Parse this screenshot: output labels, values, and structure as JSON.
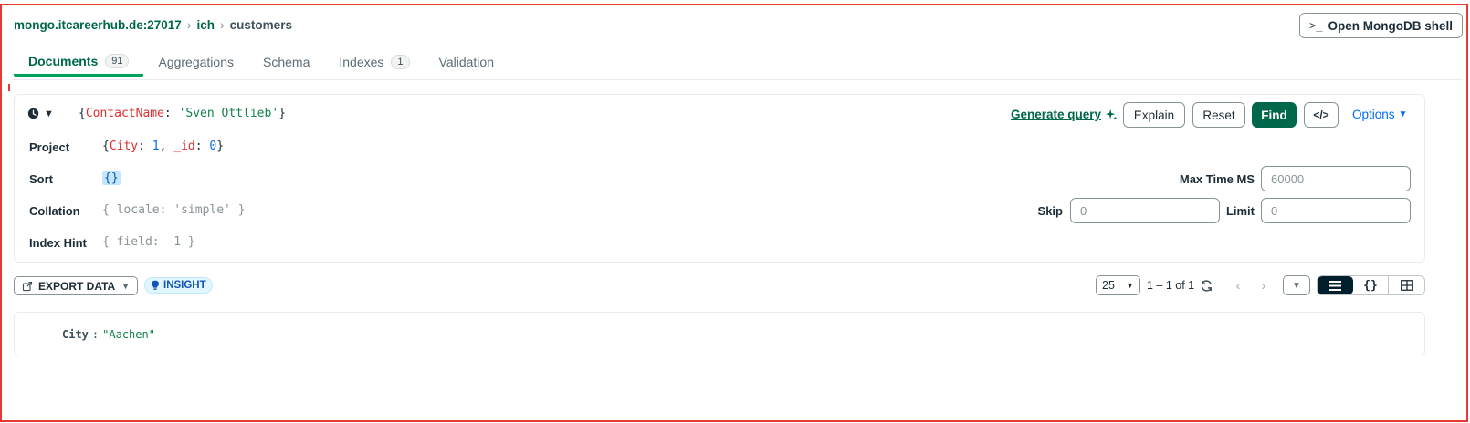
{
  "breadcrumb": {
    "host": "mongo.itcareerhub.de:27017",
    "database": "ich",
    "collection": "customers",
    "separator": ">"
  },
  "shell_button": {
    "prompt": ">_",
    "label": "Open MongoDB shell"
  },
  "tabs": [
    {
      "label": "Documents",
      "badge": "91"
    },
    {
      "label": "Aggregations"
    },
    {
      "label": "Schema"
    },
    {
      "label": "Indexes",
      "badge": "1"
    },
    {
      "label": "Validation"
    }
  ],
  "query": {
    "filter": {
      "open": "{",
      "key": "ContactName",
      "colon": ":",
      "value": "'Sven Ottlieb'",
      "close": "}"
    },
    "generate_query": "Generate query",
    "buttons": {
      "explain": "Explain",
      "reset": "Reset",
      "find": "Find",
      "code": "</>",
      "options": "Options"
    },
    "rows": {
      "project": {
        "label": "Project",
        "open": "{",
        "k1": "City",
        "v1": "1",
        "sep": ",",
        "k2": "_id",
        "v2": "0",
        "close": "}"
      },
      "sort": {
        "label": "Sort",
        "value": "{}"
      },
      "collation": {
        "label": "Collation",
        "placeholder": "{ locale: 'simple' }"
      },
      "index_hint": {
        "label": "Index Hint",
        "placeholder": "{ field: -1 }"
      }
    },
    "max_time_ms": {
      "label": "Max Time MS",
      "placeholder": "60000"
    },
    "skip": {
      "label": "Skip",
      "placeholder": "0"
    },
    "limit": {
      "label": "Limit",
      "placeholder": "0"
    }
  },
  "toolbar": {
    "export": "EXPORT DATA",
    "insight": "INSIGHT",
    "page_size": "25",
    "range": "1 – 1 of 1"
  },
  "documents": [
    {
      "key": "City",
      "value": "\"Aachen\""
    }
  ],
  "colors": {
    "accent": "#00684a",
    "find_bg": "#00684a",
    "link": "#016bf8",
    "frame": "#e53935"
  }
}
